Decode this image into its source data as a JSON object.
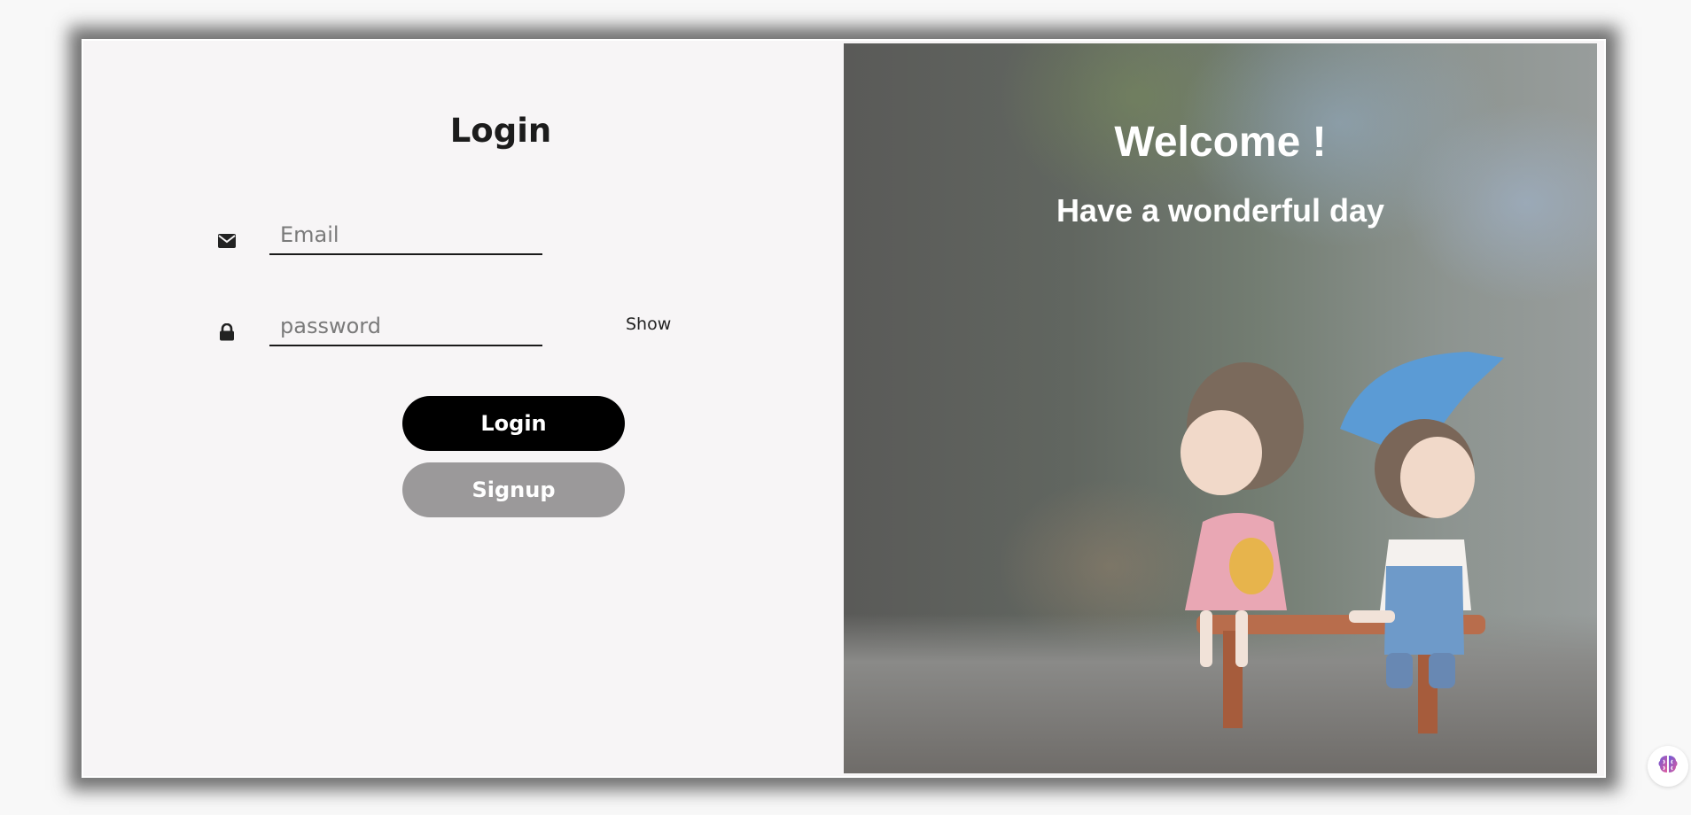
{
  "login_form": {
    "title": "Login",
    "email": {
      "placeholder": "Email",
      "value": "",
      "icon": "envelope-icon"
    },
    "password": {
      "placeholder": "password",
      "value": "",
      "icon": "lock-icon",
      "toggle_label": "Show"
    },
    "login_button": "Login",
    "signup_button": "Signup"
  },
  "welcome_panel": {
    "heading": "Welcome !",
    "subheading": "Have a wonderful day",
    "image": "figurines-on-bench"
  },
  "assistant": {
    "icon": "brain-icon"
  },
  "colors": {
    "panel_background": "#f7f5f6",
    "login_button": "#000000",
    "signup_button": "#9b999a",
    "heading_text": "#1c1c1c"
  }
}
